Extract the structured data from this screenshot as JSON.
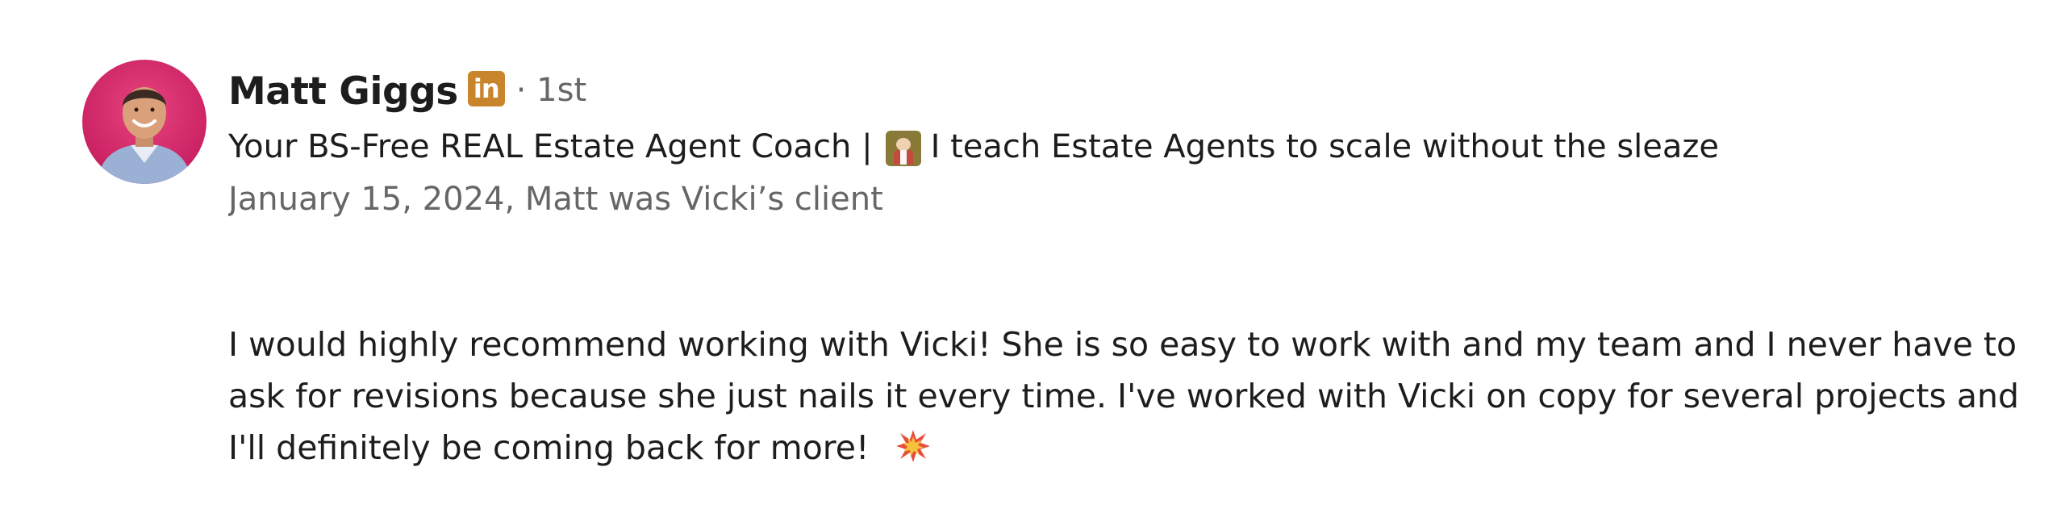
{
  "reviewer": {
    "name": "Matt Giggs",
    "badge_text": "in",
    "degree": "· 1st",
    "headline_before": "Your BS-Free REAL Estate Agent Coach |",
    "headline_after": "I teach Estate Agents to scale without the sleaze",
    "headline_emoji_icon": "man-in-suit-emoji-icon",
    "meta": "January 15, 2024, Matt was Vicki’s client"
  },
  "review": {
    "text": "I would highly recommend working with Vicki! She is so easy to work with and my team and I never have to ask for revisions because she just nails it every time. I've worked with Vicki on copy for several projects and I'll definitely be coming back for more!",
    "trailing_emoji_icon": "collision-emoji-icon"
  },
  "colors": {
    "avatar_background": "#d62a6e",
    "badge": "#c9852b",
    "text_primary": "#1d1d1d",
    "text_secondary": "#666666"
  }
}
